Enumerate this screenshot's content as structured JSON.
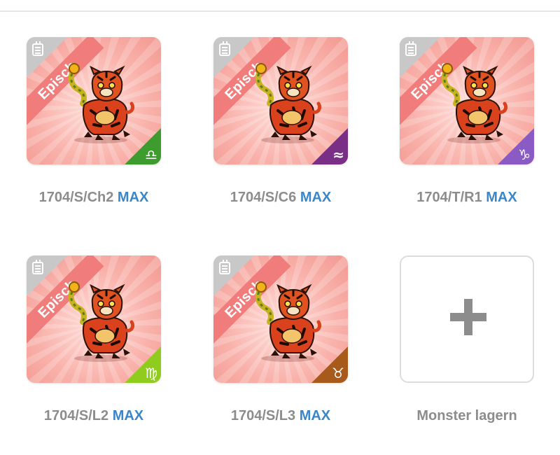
{
  "items": [
    {
      "rarity": "Episch",
      "code": "1704/S/Ch2",
      "max_label": "MAX",
      "zodiac_icon": "libra-icon",
      "zodiac_glyph": "♎",
      "zodiac_color": "#3e9b2e"
    },
    {
      "rarity": "Episch",
      "code": "1704/S/C6",
      "max_label": "MAX",
      "zodiac_icon": "aquarius-icon",
      "zodiac_glyph": "≈",
      "zodiac_color": "#7a2f86"
    },
    {
      "rarity": "Episch",
      "code": "1704/T/R1",
      "max_label": "MAX",
      "zodiac_icon": "capricorn-icon",
      "zodiac_glyph": "♑",
      "zodiac_color": "#8a5bc4"
    },
    {
      "rarity": "Episch",
      "code": "1704/S/L2",
      "max_label": "MAX",
      "zodiac_icon": "virgo-icon",
      "zodiac_glyph": "♍",
      "zodiac_color": "#8fcc1e"
    },
    {
      "rarity": "Episch",
      "code": "1704/S/L3",
      "max_label": "MAX",
      "zodiac_icon": "taurus-icon",
      "zodiac_glyph": "♉",
      "zodiac_color": "#a85a1a"
    }
  ],
  "add_slot": {
    "label": "Monster lagern",
    "icon": "plus-icon"
  }
}
